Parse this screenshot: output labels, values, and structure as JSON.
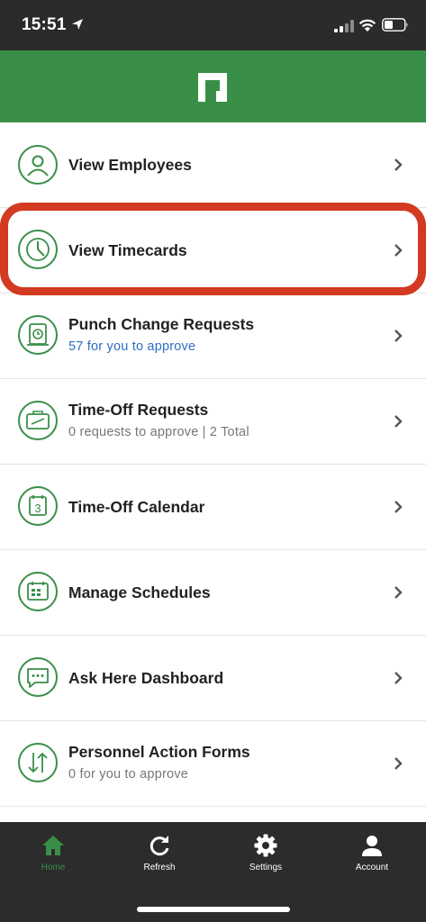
{
  "status_bar": {
    "time": "15:51"
  },
  "menu": {
    "items": [
      {
        "title": "View Employees",
        "subtitle": ""
      },
      {
        "title": "View Timecards",
        "subtitle": ""
      },
      {
        "title": "Punch Change Requests",
        "subtitle": "57 for you to approve"
      },
      {
        "title": "Time-Off Requests",
        "subtitle": "0 requests to approve | 2 Total"
      },
      {
        "title": "Time-Off Calendar",
        "subtitle": ""
      },
      {
        "title": "Manage Schedules",
        "subtitle": ""
      },
      {
        "title": "Ask Here Dashboard",
        "subtitle": ""
      },
      {
        "title": "Personnel Action Forms",
        "subtitle": "0 for you to approve"
      }
    ]
  },
  "tabbar": {
    "tabs": [
      {
        "label": "Home",
        "icon": "home-icon",
        "active": true
      },
      {
        "label": "Refresh",
        "icon": "refresh-icon"
      },
      {
        "label": "Settings",
        "icon": "gear-icon"
      },
      {
        "label": "Account",
        "icon": "person-icon"
      }
    ]
  },
  "colors": {
    "brand_green": "#3a8f48",
    "highlight_red": "#d23a21",
    "link_blue": "#2f6fc4"
  }
}
